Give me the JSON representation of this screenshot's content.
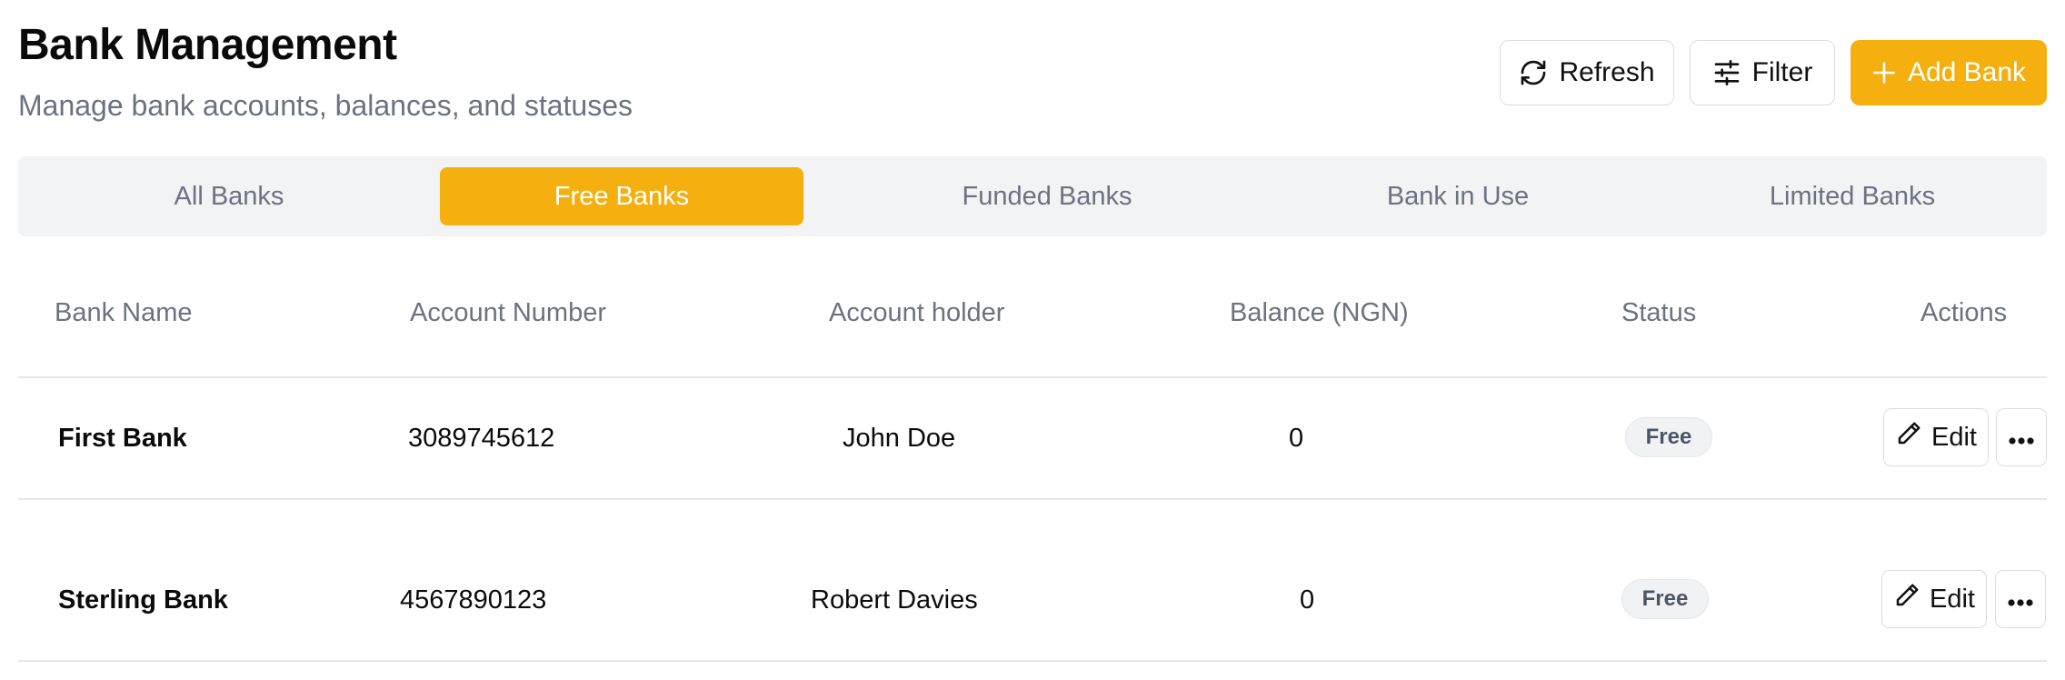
{
  "header": {
    "title": "Bank Management",
    "subtitle": "Manage bank accounts, balances, and statuses",
    "refresh_label": "Refresh",
    "filter_label": "Filter",
    "add_label": "Add Bank"
  },
  "tabs": [
    {
      "label": "All Banks",
      "active": false
    },
    {
      "label": "Free Banks",
      "active": true
    },
    {
      "label": "Funded Banks",
      "active": false
    },
    {
      "label": "Bank in Use",
      "active": false
    },
    {
      "label": "Limited Banks",
      "active": false
    }
  ],
  "table": {
    "columns": [
      "Bank Name",
      "Account Number",
      "Account holder",
      "Balance (NGN)",
      "Status",
      "Actions"
    ],
    "rows": [
      {
        "name": "First Bank",
        "account_number": "3089745612",
        "holder": "John Doe",
        "balance": "0",
        "status": "Free",
        "edit_label": "Edit"
      },
      {
        "name": "Sterling Bank",
        "account_number": "4567890123",
        "holder": "Robert Davies",
        "balance": "0",
        "status": "Free",
        "edit_label": "Edit"
      }
    ]
  },
  "colors": {
    "accent": "#f5b00f",
    "muted_text": "#6b7280",
    "tab_bg": "#f2f3f5",
    "border": "#e5e7eb"
  },
  "icons": {
    "refresh": "refresh-icon",
    "filter": "sliders-icon",
    "add": "plus-icon",
    "edit": "pencil-icon",
    "more": "more-horizontal-icon"
  }
}
